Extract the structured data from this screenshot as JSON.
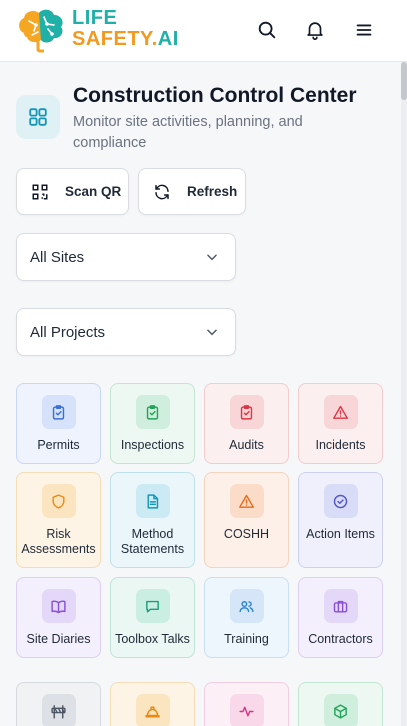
{
  "header": {
    "logo_line1": "LIFE",
    "logo_line2": "SAFETY.",
    "logo_line2_suffix": "AI",
    "icons": [
      "search-icon",
      "bell-icon",
      "menu-icon"
    ]
  },
  "page": {
    "title": "Construction Control Center",
    "subtitle": "Monitor site activities, planning, and compliance"
  },
  "actions": {
    "scan_label": "Scan QR",
    "refresh_label": "Refresh"
  },
  "filters": {
    "sites_value": "All Sites",
    "projects_value": "All Projects"
  },
  "tiles": [
    {
      "label": "Permits",
      "icon": "clipboard-check-icon",
      "bg": "#eef3fd",
      "border": "#c9d7f5",
      "icon_bg": "#d5e2fa",
      "icon_color": "#3b6fd8"
    },
    {
      "label": "Inspections",
      "icon": "clipboard-check-icon",
      "bg": "#ecf8f1",
      "border": "#c3e6d2",
      "icon_bg": "#cfeedd",
      "icon_color": "#22a35a"
    },
    {
      "label": "Audits",
      "icon": "clipboard-check-icon",
      "bg": "#fcefef",
      "border": "#f3cccc",
      "icon_bg": "#f8d6d8",
      "icon_color": "#dc3545"
    },
    {
      "label": "Incidents",
      "icon": "alert-triangle-icon",
      "bg": "#fcefef",
      "border": "#f3cccc",
      "icon_bg": "#f8d6d8",
      "icon_color": "#dc3545"
    },
    {
      "label": "Risk Assessments",
      "icon": "shield-icon",
      "bg": "#fdf4e6",
      "border": "#f3ddb6",
      "icon_bg": "#fbe5c0",
      "icon_color": "#ea8a12"
    },
    {
      "label": "Method Statements",
      "icon": "document-icon",
      "bg": "#eaf6fa",
      "border": "#bfe1ec",
      "icon_bg": "#cceaf3",
      "icon_color": "#1496b8"
    },
    {
      "label": "COSHH",
      "icon": "alert-triangle-icon",
      "bg": "#fdf0e8",
      "border": "#f4d3bf",
      "icon_bg": "#fbdcc8",
      "icon_color": "#ea6a1a"
    },
    {
      "label": "Action Items",
      "icon": "check-circle-icon",
      "bg": "#eff0fb",
      "border": "#cdd0f1",
      "icon_bg": "#d9dcf7",
      "icon_color": "#4f54c9"
    },
    {
      "label": "Site Diaries",
      "icon": "book-icon",
      "bg": "#f4effc",
      "border": "#dccff4",
      "icon_bg": "#e4d8f8",
      "icon_color": "#8a4fd6"
    },
    {
      "label": "Toolbox Talks",
      "icon": "message-icon",
      "bg": "#eaf7f3",
      "border": "#bfe5d8",
      "icon_bg": "#cbeee2",
      "icon_color": "#18a07a"
    },
    {
      "label": "Training",
      "icon": "users-icon",
      "bg": "#eef6fd",
      "border": "#c9dff3",
      "icon_bg": "#d4e6f8",
      "icon_color": "#2b83d3"
    },
    {
      "label": "Contractors",
      "icon": "briefcase-icon",
      "bg": "#f4effc",
      "border": "#dccff4",
      "icon_bg": "#e4d8f8",
      "icon_color": "#8a4fd6"
    },
    {
      "label": "",
      "icon": "barrier-icon",
      "bg": "#f1f2f4",
      "border": "#d6d9de",
      "icon_bg": "#dde0e5",
      "icon_color": "#4b5563"
    },
    {
      "label": "",
      "icon": "hard-hat-icon",
      "bg": "#fdf4e6",
      "border": "#f3ddb6",
      "icon_bg": "#fbe5c0",
      "icon_color": "#ea8a12"
    },
    {
      "label": "",
      "icon": "activity-icon",
      "bg": "#fcf0f6",
      "border": "#f1cde0",
      "icon_bg": "#f8d8e9",
      "icon_color": "#d63384"
    },
    {
      "label": "",
      "icon": "box-icon",
      "bg": "#ecf8f1",
      "border": "#c3e6d2",
      "icon_bg": "#cfeedd",
      "icon_color": "#22a35a"
    }
  ]
}
